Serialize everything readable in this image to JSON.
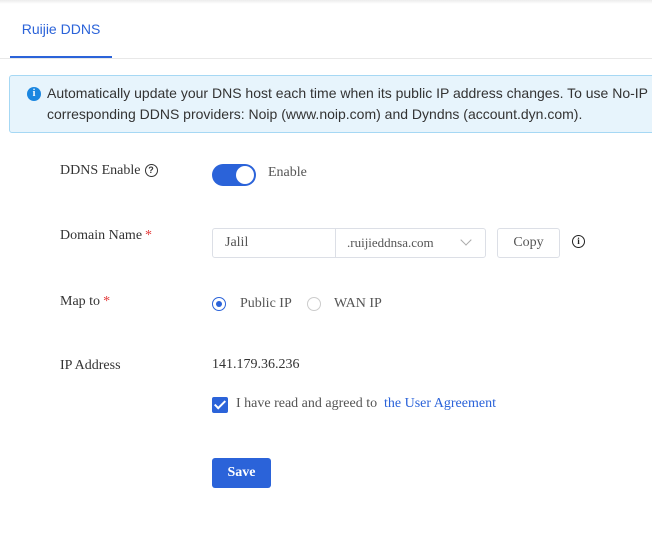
{
  "tabs": [
    {
      "label": "Ruijie DDNS",
      "active": true
    }
  ],
  "banner": {
    "icon": "info-icon",
    "line1": "Automatically update your DNS host each time when its public IP address changes. To use No-IP o",
    "line2": "corresponding DDNS providers: Noip (www.noip.com) and Dyndns (account.dyn.com)."
  },
  "form": {
    "ddns_enable": {
      "label": "DDNS Enable",
      "toggle_on": true,
      "toggle_text": "Enable"
    },
    "domain_name": {
      "label": "Domain Name",
      "required_mark": "*",
      "value": "Jalil",
      "suffix_selected": ".ruijieddnsa.com",
      "copy_label": "Copy"
    },
    "map_to": {
      "label": "Map to",
      "required_mark": "*",
      "options": [
        {
          "label": "Public IP",
          "selected": true
        },
        {
          "label": "WAN IP",
          "selected": false
        }
      ]
    },
    "ip_address": {
      "label": "IP Address",
      "value": "141.179.36.236"
    },
    "agreement": {
      "checked": true,
      "text": "I have read and agreed to",
      "link_text": "the User Agreement"
    },
    "save_label": "Save"
  },
  "colors": {
    "accent": "#2b63d9",
    "required": "#e33a3a",
    "banner_bg": "#e7f4fc",
    "banner_border": "#a6d8f4"
  }
}
